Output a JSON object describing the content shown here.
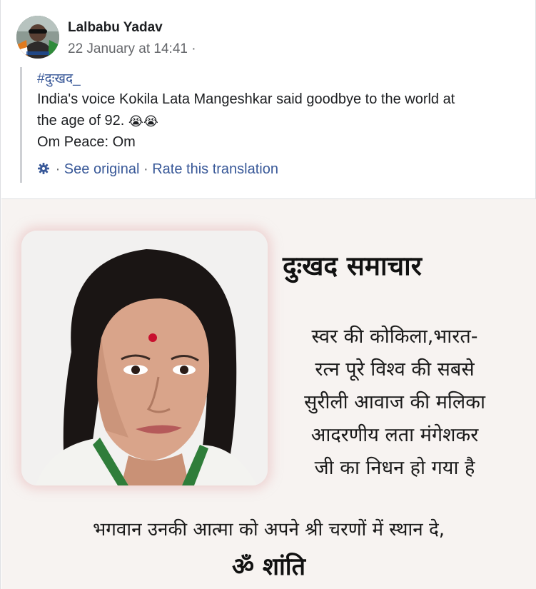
{
  "post": {
    "author": "Lalbabu Yadav",
    "timestamp": "22 January at 14:41",
    "meta_separator": "·",
    "hashtag": "#दुःखद_",
    "translated_line1": "India's voice Kokila Lata Mangeshkar said goodbye to the world at",
    "translated_line2": "the age of 92.",
    "translated_line2_emoji": "😭😭",
    "translated_line3": "Om Peace: Om",
    "see_original": "See original",
    "rate_translation": "Rate this translation",
    "link_separator": "·"
  },
  "image_text": {
    "headline": "दुःखद समाचार",
    "body_lines": [
      "स्वर की कोकिला,भारत-",
      "रत्न पूरे विश्व की सबसे",
      "सुरीली आवाज की मलिका",
      "आदरणीय लता मंगेशकर",
      "जी का निधन हो गया है"
    ],
    "prayer": "भगवान उनकी आत्मा को अपने श्री चरणों में स्थान दे,",
    "shanti": "ॐ शांति"
  },
  "colors": {
    "link": "#385898",
    "meta": "#65676b",
    "image_background": "#f7f3f1"
  },
  "icons": {
    "settings": "gear-icon",
    "avatar": "profile-photo"
  }
}
